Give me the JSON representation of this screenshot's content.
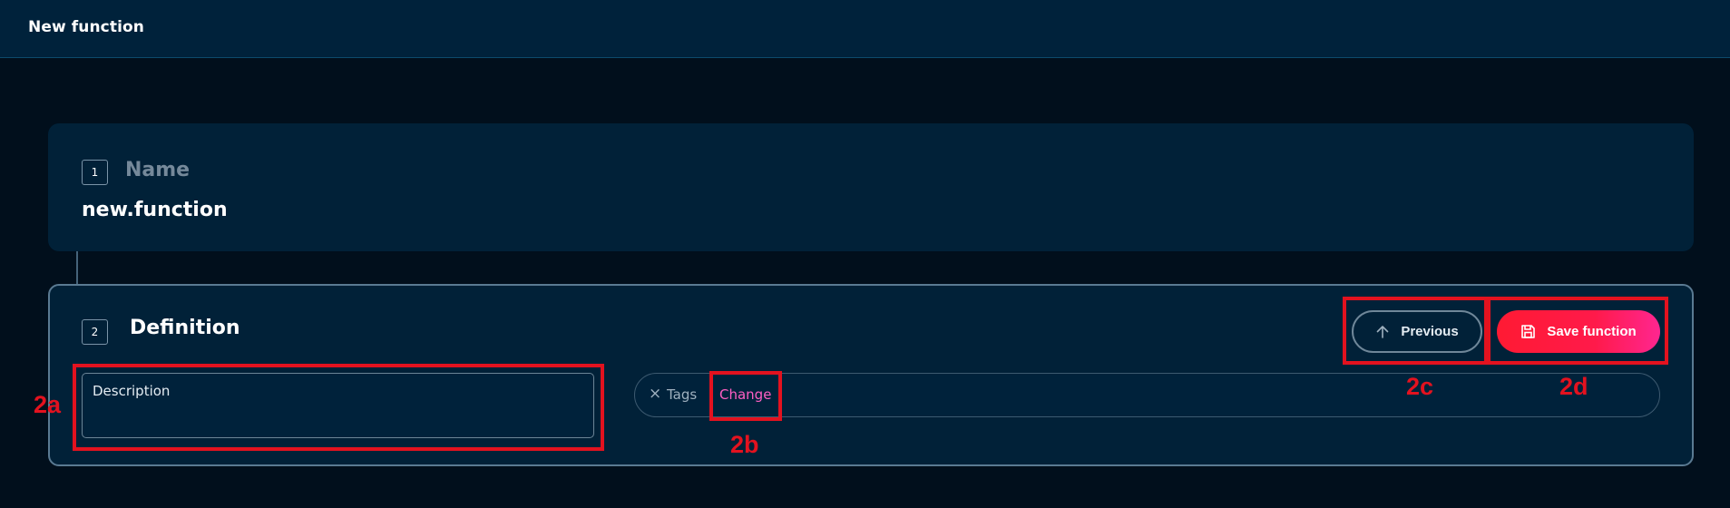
{
  "header": {
    "title": "New function"
  },
  "steps": [
    {
      "number": "1",
      "title": "Name",
      "value": "new.function"
    },
    {
      "number": "2",
      "title": "Definition"
    }
  ],
  "definition": {
    "description_placeholder": "Description",
    "tags": {
      "clear_glyph": "×",
      "label": "Tags",
      "change_label": "Change"
    },
    "previous_label": "Previous",
    "save_label": "Save function"
  },
  "annotations": {
    "a": "2a",
    "b": "2b",
    "c": "2c",
    "d": "2d"
  },
  "icons": {
    "previous": "arrow-up-icon",
    "save": "floppy-disk-icon",
    "tag_clear": "close-icon"
  },
  "colors": {
    "accent_pink": "#ff5fc4",
    "save_gradient_start": "#ff1a33",
    "save_gradient_end": "#ff2690",
    "annotation_red": "#e3121f",
    "background": "#010f1c",
    "card": "#012138"
  }
}
